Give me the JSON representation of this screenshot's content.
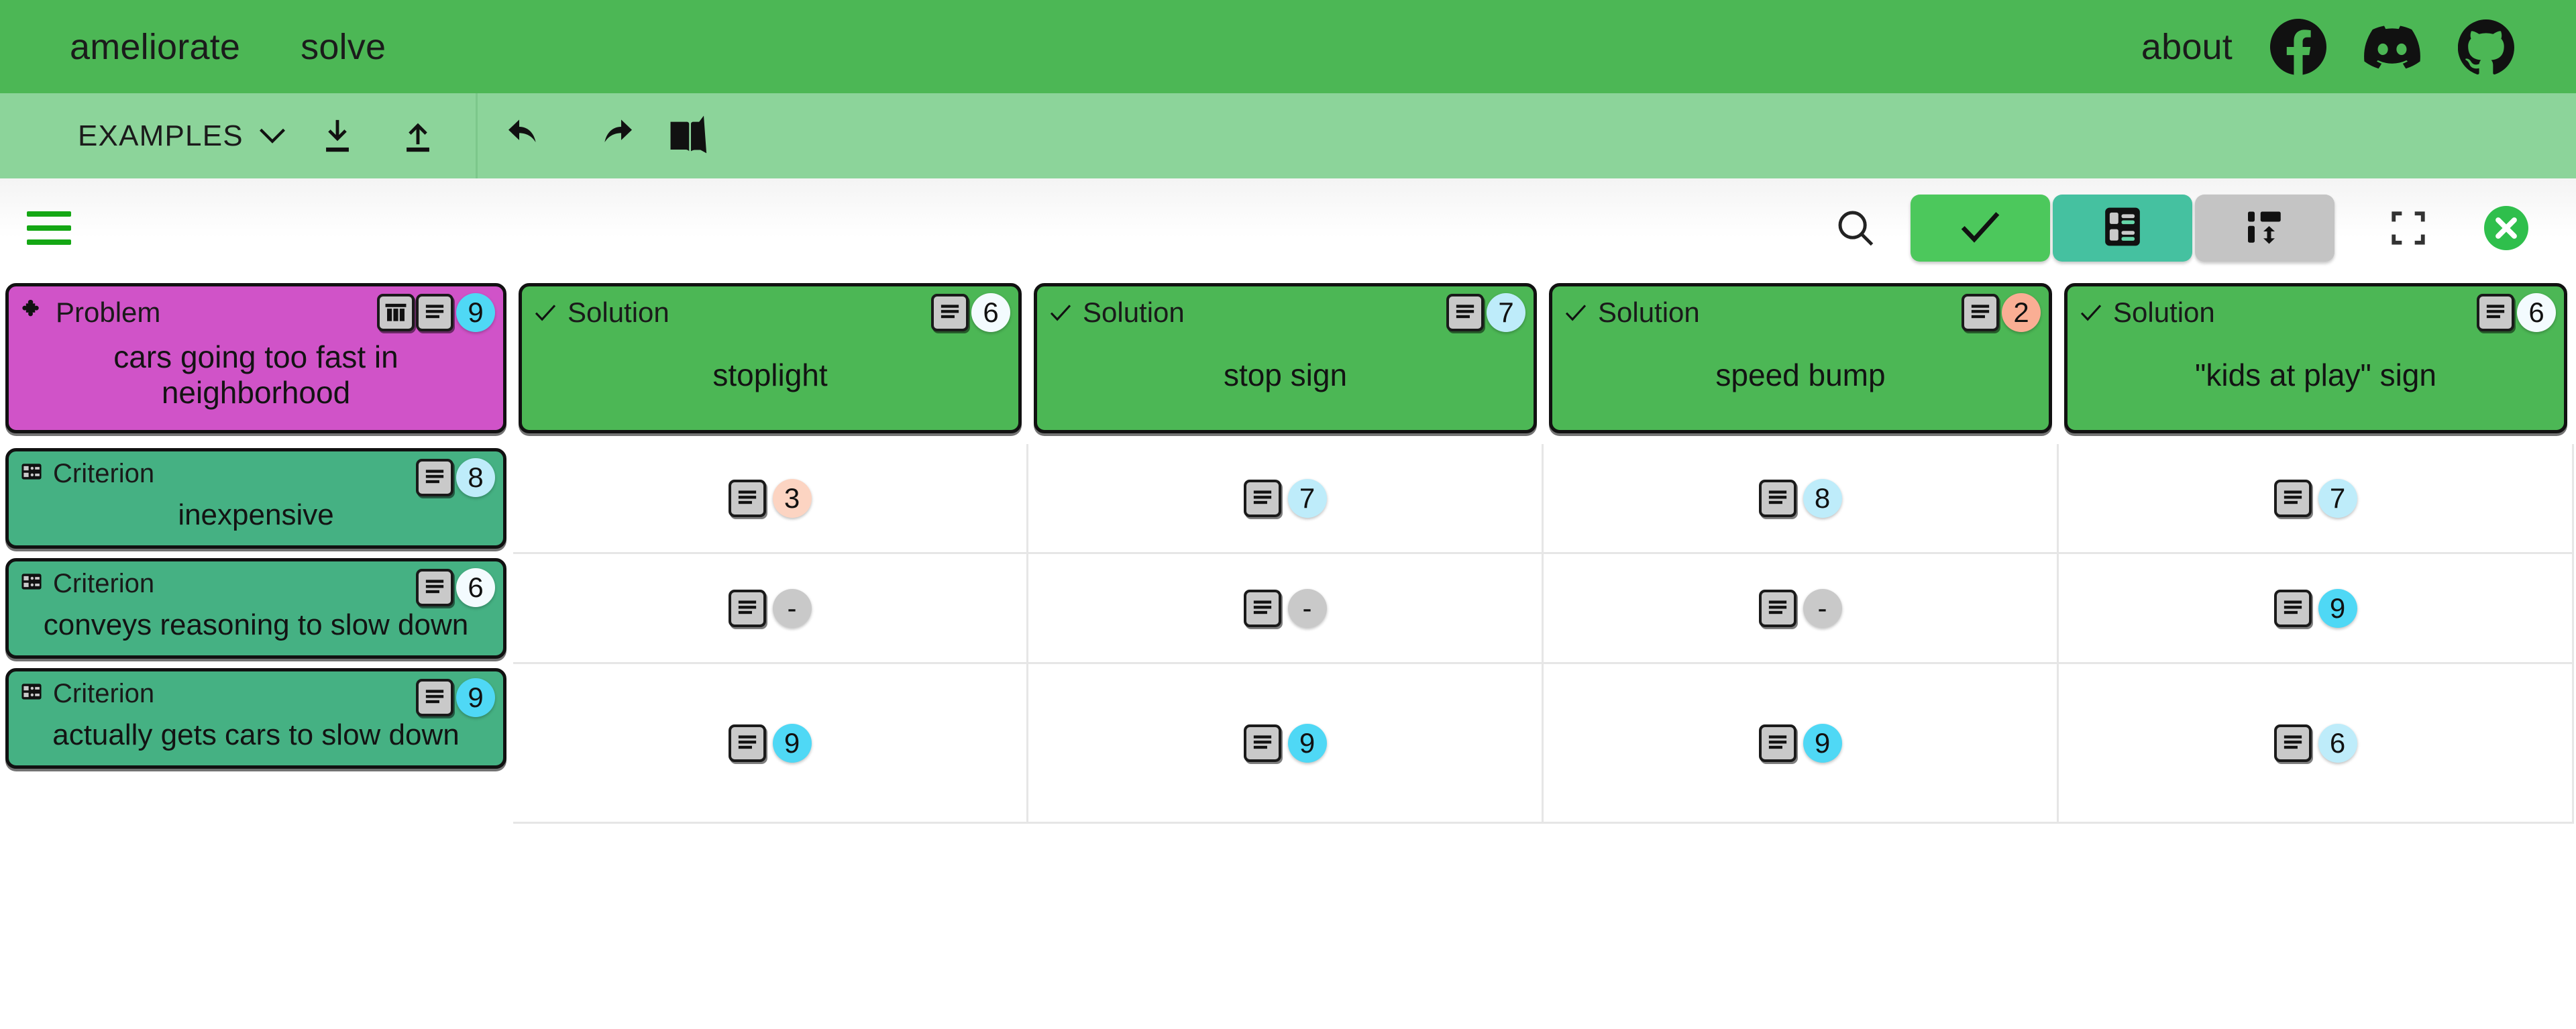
{
  "topnav": {
    "brand": "ameliorate",
    "links": [
      "solve"
    ],
    "about": "about",
    "social": [
      {
        "name": "facebook-icon"
      },
      {
        "name": "discord-icon"
      },
      {
        "name": "github-icon"
      }
    ]
  },
  "toolbar": {
    "examples_label": "EXAMPLES",
    "chevron": "chevron-down-icon",
    "buttons": [
      {
        "name": "download-icon",
        "title": "Download"
      },
      {
        "name": "upload-icon",
        "title": "Upload"
      },
      {
        "name": "undo-icon",
        "title": "Undo"
      },
      {
        "name": "redo-icon",
        "title": "Redo"
      },
      {
        "name": "tutorial-book-icon",
        "title": "Tutorial"
      }
    ]
  },
  "controlbar": {
    "menu": "hamburger-menu-icon",
    "search": "search-icon",
    "segments": [
      {
        "name": "checkmark-toggle",
        "state": "active-green",
        "icon": "check-icon"
      },
      {
        "name": "table-view-toggle",
        "state": "active-teal",
        "icon": "table-layout-icon"
      },
      {
        "name": "flow-view-toggle",
        "state": "inactive",
        "icon": "flow-swap-icon"
      }
    ],
    "fullscreen": "fullscreen-icon",
    "close": "close-circle-icon"
  },
  "colors": {
    "nav_green": "#4CB755",
    "toolbar_green": "#8CD49A",
    "problem_magenta": "#D053C8",
    "solution_green": "#4CB755",
    "criterion_teal": "#45B183",
    "badge_cyan": "#4FD8F5",
    "badge_light_cyan": "#BEECFA",
    "badge_white": "#F3FBFE",
    "badge_peach": "#FCD4C2",
    "badge_salmon": "#FAAE94",
    "badge_gray": "#C9C9C9"
  },
  "table": {
    "problem": {
      "type_label": "Problem",
      "type_icon": "puzzle-piece-icon",
      "title": "cars going too fast in neighborhood",
      "chips": [
        "table-columns-icon",
        "details-list-icon"
      ],
      "score": "9",
      "score_class": "b-cyan"
    },
    "solutions": [
      {
        "type_label": "Solution",
        "type_icon": "check-icon",
        "title": "stoplight",
        "chip": "details-list-icon",
        "score": "6",
        "score_class": "b-white"
      },
      {
        "type_label": "Solution",
        "type_icon": "check-icon",
        "title": "stop sign",
        "chip": "details-list-icon",
        "score": "7",
        "score_class": "b-lcyan"
      },
      {
        "type_label": "Solution",
        "type_icon": "check-icon",
        "title": "speed bump",
        "chip": "details-list-icon",
        "score": "2",
        "score_class": "b-salmon"
      },
      {
        "type_label": "Solution",
        "type_icon": "check-icon",
        "title": "\"kids at play\" sign",
        "chip": "details-list-icon",
        "score": "6",
        "score_class": "b-white"
      }
    ],
    "criteria": [
      {
        "type_label": "Criterion",
        "type_icon": "criterion-grid-icon",
        "title": "inexpensive",
        "chip": "details-list-icon",
        "score": "8",
        "score_class": "b-lcyan",
        "cells": [
          {
            "chip": "details-list-icon",
            "score": "3",
            "score_class": "b-peach"
          },
          {
            "chip": "details-list-icon",
            "score": "7",
            "score_class": "b-lcyan"
          },
          {
            "chip": "details-list-icon",
            "score": "8",
            "score_class": "b-lcyan"
          },
          {
            "chip": "details-list-icon",
            "score": "7",
            "score_class": "b-lcyan"
          }
        ]
      },
      {
        "type_label": "Criterion",
        "type_icon": "criterion-grid-icon",
        "title": "conveys reasoning to slow down",
        "chip": "details-list-icon",
        "score": "6",
        "score_class": "b-white",
        "cells": [
          {
            "chip": "details-list-icon",
            "score": "-",
            "score_class": "b-gray"
          },
          {
            "chip": "details-list-icon",
            "score": "-",
            "score_class": "b-gray"
          },
          {
            "chip": "details-list-icon",
            "score": "-",
            "score_class": "b-gray"
          },
          {
            "chip": "details-list-icon",
            "score": "9",
            "score_class": "b-cyan"
          }
        ]
      },
      {
        "type_label": "Criterion",
        "type_icon": "criterion-grid-icon",
        "title": "actually gets cars to slow down",
        "chip": "details-list-icon",
        "score": "9",
        "score_class": "b-cyan",
        "cells": [
          {
            "chip": "details-list-icon",
            "score": "9",
            "score_class": "b-cyan"
          },
          {
            "chip": "details-list-icon",
            "score": "9",
            "score_class": "b-cyan"
          },
          {
            "chip": "details-list-icon",
            "score": "9",
            "score_class": "b-cyan"
          },
          {
            "chip": "details-list-icon",
            "score": "6",
            "score_class": "b-lcyan"
          }
        ]
      }
    ]
  }
}
